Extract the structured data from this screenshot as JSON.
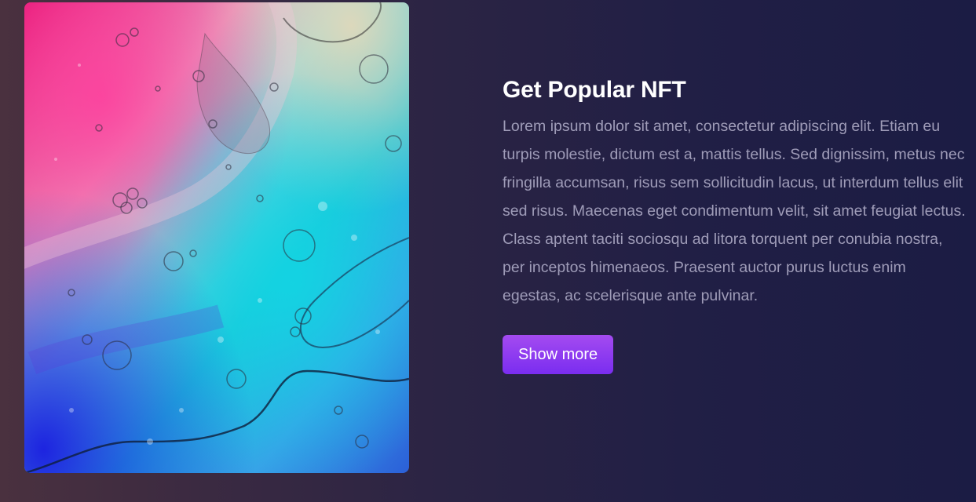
{
  "hero": {
    "title": "Get Popular NFT",
    "description": "Lorem ipsum dolor sit amet, consectetur adipiscing elit. Etiam eu turpis molestie, dictum est a, mattis tellus. Sed dignissim, metus nec fringilla accumsan, risus sem sollicitudin lacus, ut interdum tellus elit sed risus. Maecenas eget condimentum velit, sit amet feugiat lectus. Class aptent taciti sociosqu ad litora torquent per conubia nostra, per inceptos himenaeos. Praesent auctor purus luctus enim egestas, ac scelerisque ante pulvinar.",
    "button_label": "Show more"
  },
  "colors": {
    "button": "#8a38f5",
    "title": "#ffffff",
    "description": "#9f9cb8"
  }
}
